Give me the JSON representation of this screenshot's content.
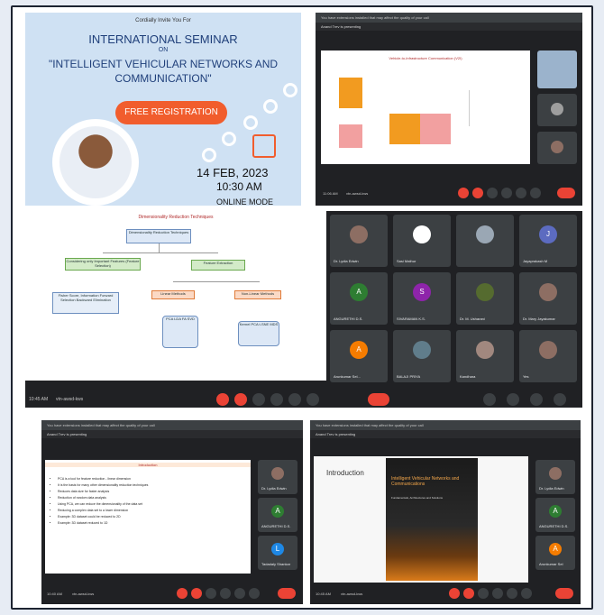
{
  "poster": {
    "invite": "Cordially Invite You For",
    "line1": "INTERNATIONAL SEMINAR",
    "line2": "ON",
    "line3": "\"INTELLIGENT VEHICULAR NETWORKS AND",
    "line4": "COMMUNICATION\"",
    "registration": "FREE REGISTRATION",
    "date": "14 FEB, 2023",
    "time": "10:30 AM",
    "mode": "ONLINE MODE"
  },
  "meet1": {
    "banner": "You have extensions installed that may affect the quality of your call",
    "presenting": "Anand Trev is presenting",
    "slide_title": "Vehicle-to-Infrastructure Communication (V2I)",
    "time": "11:06 AM",
    "code": "vtn-awsd-kws"
  },
  "meet2": {
    "slide_title": "Dimensionality Reduction Techniques",
    "root": "Dimensionality Reduction Techniques",
    "left": "Considering only Important Features (Feature Selection)",
    "right": "Feature Extraction",
    "fs": "Fisher Score, Information Forward Selection Backward Elimination",
    "linear": "Linear Methods",
    "nonlinear": "Non-Linear Methods",
    "lin_list": "PCA LDA FA SVD",
    "nl_list": "Kernel PCA t-SNE MDS",
    "time": "10:45 AM",
    "code": "vtn-awsd-kws",
    "participants": [
      {
        "name": "Dr. Lydia Edwin",
        "initial": "",
        "color": "#8d6e63"
      },
      {
        "name": "Sasi Mathur",
        "initial": "",
        "color": "#ffffff"
      },
      {
        "name": "",
        "initial": "",
        "color": "#9aa7b4"
      },
      {
        "name": "Jayaprakash M",
        "initial": "J",
        "color": "#5c6bc0"
      },
      {
        "name": "ANGURETHI D.S.",
        "initial": "A",
        "color": "#2e7d32"
      },
      {
        "name": "SIVARAMAN K.S.",
        "initial": "S",
        "color": "#8e24aa"
      },
      {
        "name": "Dr. M. Usharani",
        "initial": "",
        "color": "#556b2f"
      },
      {
        "name": "Dr. Mary Jayakumar",
        "initial": "",
        "color": "#8d6e63"
      },
      {
        "name": "Arunkumar Sel...",
        "initial": "A",
        "color": "#f57c00"
      },
      {
        "name": "BALAJI PRIYA",
        "initial": "",
        "color": "#607d8b"
      },
      {
        "name": "Kandhara",
        "initial": "",
        "color": "#a1887f"
      },
      {
        "name": "Yes",
        "initial": "",
        "color": "#8d6e63"
      }
    ]
  },
  "meet3": {
    "banner": "You have extensions installed that may affect the quality of your call",
    "presenting": "Anand Trev is presenting",
    "slide_title": "Introduction",
    "bullets": [
      "PCA is a tool for feature reduction - linear dimension",
      "It is the basis for many other dimensionality reduction techniques",
      "Reduces data size for faster analysis",
      "Reduction of random data analysis",
      "Using PCA, we can reduce the dimensionality of the data set",
      "Reducing a complex data set to a lower dimension",
      "Example: 3D dataset could be reduced to 2D",
      "Example: 3D dataset reduced to 1D"
    ],
    "tiles": [
      "Dr. Lydia Edwin",
      "ANGURETHI D.S.",
      "Tadadaly Shankar"
    ],
    "time": "10:40 AM",
    "code": "vtn-awsd-kws"
  },
  "meet4": {
    "banner": "You have extensions installed that may affect the quality of your call",
    "presenting": "Anand Trev is presenting",
    "slide_title": "Introduction",
    "book_title": "Intelligent Vehicular Networks and Communications",
    "book_sub": "Fundamentals, Architectures and Solutions",
    "tiles": [
      "Dr. Lydia Edwin",
      "ANGURETHI D.S.",
      "Arunkumar Sel"
    ],
    "time": "10:45 AM",
    "code": "vtn-awsd-kws"
  }
}
